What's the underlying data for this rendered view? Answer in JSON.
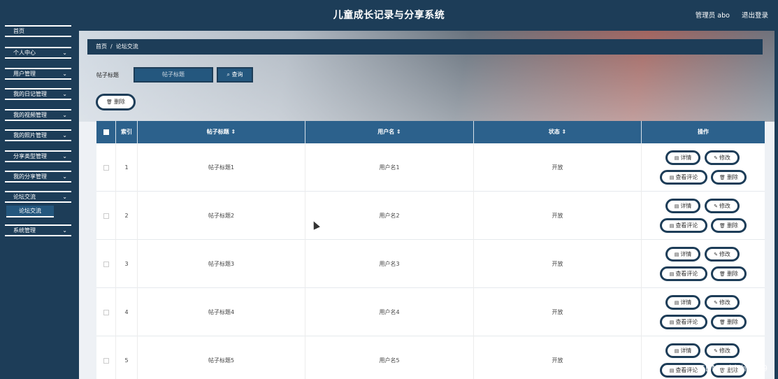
{
  "header": {
    "title": "儿童成长记录与分享系统",
    "user": "管理员 abo",
    "logout": "退出登录"
  },
  "sidebar": {
    "top_partial": "首页",
    "items": [
      {
        "label": "个人中心"
      },
      {
        "label": "用户管理"
      },
      {
        "label": "我的日记管理"
      },
      {
        "label": "我的视频管理"
      },
      {
        "label": "我的照片管理"
      },
      {
        "label": "分享类型管理"
      },
      {
        "label": "我的分享管理"
      },
      {
        "label": "论坛交流"
      },
      {
        "label": "系统管理"
      }
    ],
    "sub_item": "论坛交流",
    "chevron": "chevron-down-icon"
  },
  "breadcrumb": {
    "home": "首页",
    "separator": "/",
    "current": "论坛交流"
  },
  "filter": {
    "label": "帖子标题",
    "placeholder": "帖子标题",
    "search": "查询",
    "delete": "删除"
  },
  "table": {
    "columns": {
      "index": "索引",
      "title": "帖子标题",
      "username": "用户名",
      "status": "状态",
      "ops": "操作"
    },
    "rows": [
      {
        "index": "1",
        "title": "帖子标题1",
        "username": "用户名1",
        "status": "开放"
      },
      {
        "index": "2",
        "title": "帖子标题2",
        "username": "用户名2",
        "status": "开放"
      },
      {
        "index": "3",
        "title": "帖子标题3",
        "username": "用户名3",
        "status": "开放"
      },
      {
        "index": "4",
        "title": "帖子标题4",
        "username": "用户名4",
        "status": "开放"
      },
      {
        "index": "5",
        "title": "帖子标题5",
        "username": "用户名5",
        "status": "开放"
      }
    ],
    "ops": {
      "detail": "详情",
      "edit": "修改",
      "comment": "查看评论",
      "delete": "删除"
    }
  },
  "watermark": "CSDN @bishe409",
  "colors": {
    "primary": "#1d3d58",
    "table_header": "#2c618c",
    "accent": "#24577e"
  }
}
